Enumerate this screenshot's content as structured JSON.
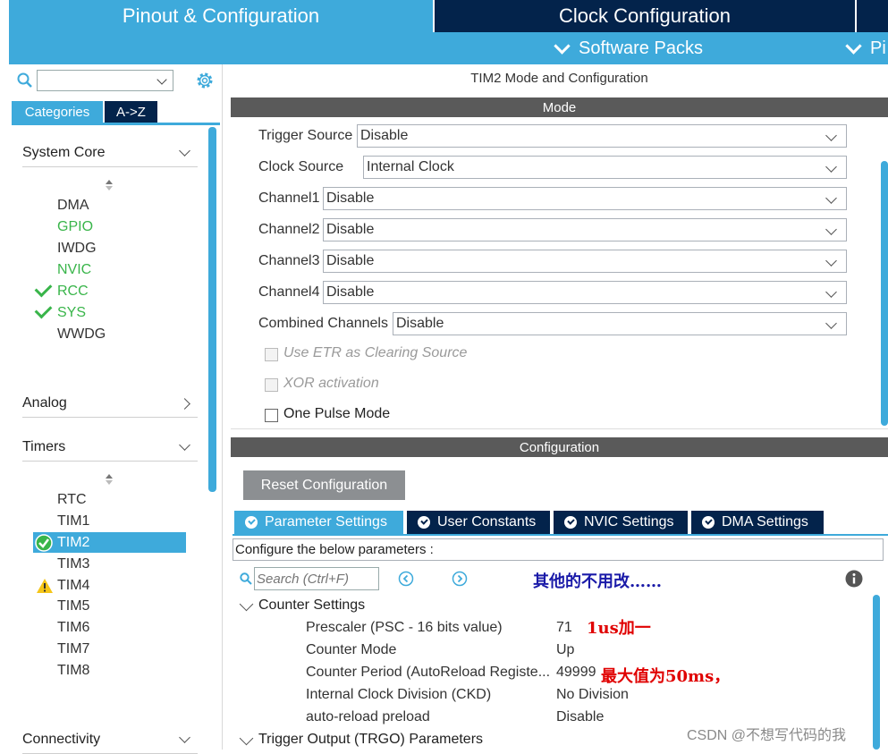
{
  "top_tabs": {
    "pinout": "Pinout & Configuration",
    "clock": "Clock Configuration"
  },
  "sub_menu": {
    "software_packs": "Software Packs",
    "pinout": "Pi"
  },
  "left": {
    "search_value": "",
    "tab_categories": "Categories",
    "tab_az": "A->Z",
    "system_core": {
      "label": "System Core",
      "items": [
        "DMA",
        "GPIO",
        "IWDG",
        "NVIC",
        "RCC",
        "SYS",
        "WWDG"
      ]
    },
    "analog": "Analog",
    "timers": {
      "label": "Timers",
      "items": [
        "RTC",
        "TIM1",
        "TIM2",
        "TIM3",
        "TIM4",
        "TIM5",
        "TIM6",
        "TIM7",
        "TIM8"
      ]
    },
    "connectivity": "Connectivity"
  },
  "main": {
    "title": "TIM2 Mode and Configuration",
    "mode_header": "Mode",
    "mode_rows": [
      {
        "label": "Trigger Source",
        "value": "Disable"
      },
      {
        "label": "Clock Source",
        "value": "Internal Clock"
      },
      {
        "label": "Channel1",
        "value": "Disable"
      },
      {
        "label": "Channel2",
        "value": "Disable"
      },
      {
        "label": "Channel3",
        "value": "Disable"
      },
      {
        "label": "Channel4",
        "value": "Disable"
      },
      {
        "label": "Combined Channels",
        "value": "Disable"
      }
    ],
    "checkboxes": [
      "Use ETR as Clearing Source",
      "XOR activation",
      "One Pulse Mode"
    ],
    "config_header": "Configuration",
    "reset_button": "Reset Configuration",
    "tabs": [
      "Parameter Settings",
      "User Constants",
      "NVIC Settings",
      "DMA Settings"
    ],
    "hint": "Configure the below parameters :",
    "search_placeholder": "Search (Ctrl+F)",
    "note": "其他的不用改……",
    "counter_settings": "Counter Settings",
    "params": [
      {
        "name": "Prescaler (PSC - 16 bits value)",
        "value": "71"
      },
      {
        "name": "Counter Mode",
        "value": "Up"
      },
      {
        "name": "Counter Period (AutoReload Registe...",
        "value": "49999"
      },
      {
        "name": "Internal Clock Division (CKD)",
        "value": "No Division"
      },
      {
        "name": "auto-reload preload",
        "value": "Disable"
      }
    ],
    "annotations": {
      "prescaler": "1us加一",
      "period": "最大值为50ms，"
    },
    "trgo": "Trigger Output (TRGO) Parameters"
  },
  "watermark": "CSDN @不想写代码的我",
  "colors": {
    "accent": "#3eaadb",
    "navy": "#03234b",
    "ok_green": "#39b54a",
    "warn": "#f5c518",
    "annotation_blue": "#1a1aa8",
    "annotation_red": "#e00000"
  }
}
